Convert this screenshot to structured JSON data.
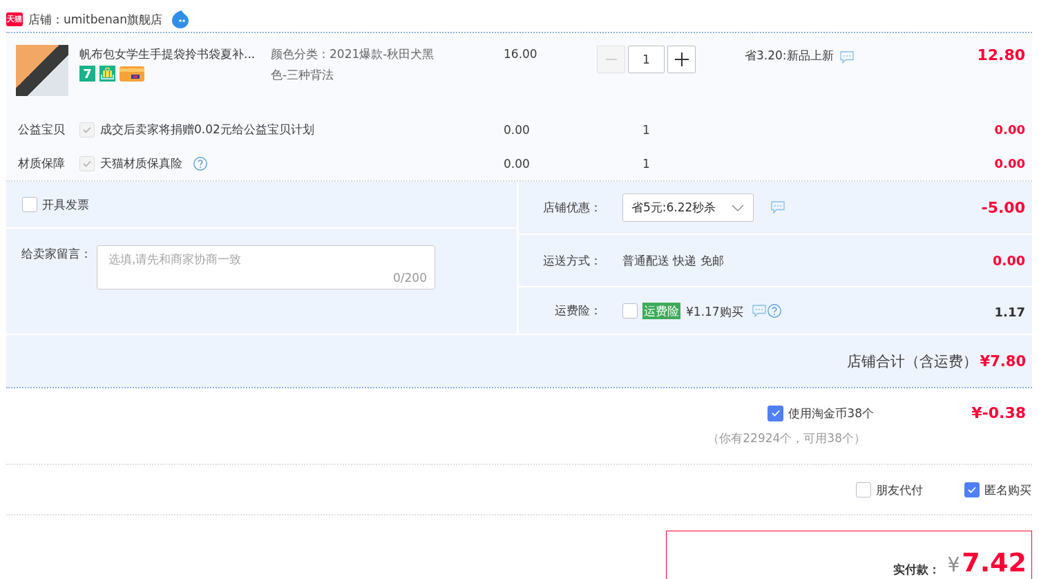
{
  "shop": {
    "badge": "天猫",
    "name": "店铺：umitbenan旗舰店"
  },
  "item": {
    "title": "帆布包女学生手提袋拎书袋夏补...",
    "badges": [
      {
        "kind": "number",
        "text": "7"
      },
      {
        "kind": "bag"
      },
      {
        "kind": "card"
      }
    ],
    "sku": "颜色分类：2021爆款-秋田犬黑色-三种背法",
    "price": "16.00",
    "quantity": "1",
    "decrease_disabled": true,
    "promo": "省3.20:新品上新",
    "total": "12.80"
  },
  "services": [
    {
      "label": "公益宝贝",
      "checked": true,
      "disabled": true,
      "text": "成交后卖家将捐赠0.02元给公益宝贝计划",
      "help": false,
      "price": "0.00",
      "quantity": "1",
      "total": "0.00"
    },
    {
      "label": "材质保障",
      "checked": true,
      "disabled": true,
      "text": "天猫材质保真险",
      "help": true,
      "price": "0.00",
      "quantity": "1",
      "total": "0.00"
    }
  ],
  "invoice": {
    "label": "开具发票",
    "checked": false
  },
  "message": {
    "label": "给卖家留言：",
    "placeholder": "选填,请先和商家协商一致",
    "counter": "0/200"
  },
  "coupon": {
    "label": "店铺优惠：",
    "value": "省5元:6.22秒杀",
    "amount": "-5.00"
  },
  "shipping": {
    "label": "运送方式：",
    "value": "普通配送 快递 免邮",
    "amount": "0.00"
  },
  "insurance": {
    "label": "运费险：",
    "checked": false,
    "tag": "运费险",
    "price": "¥1.17购买",
    "amount": "1.17"
  },
  "shop_total": {
    "label": "店铺合计（含运费）",
    "amount": "¥7.80"
  },
  "coins": {
    "checked": true,
    "label": "使用淘金币38个",
    "note": "（你有22924个，可用38个）",
    "amount": "¥-0.38"
  },
  "options": [
    {
      "label": "朋友代付",
      "checked": false
    },
    {
      "label": "匿名购买",
      "checked": true
    }
  ],
  "payment": {
    "label": "实付款：",
    "currency": "¥",
    "amount": "7.42"
  }
}
